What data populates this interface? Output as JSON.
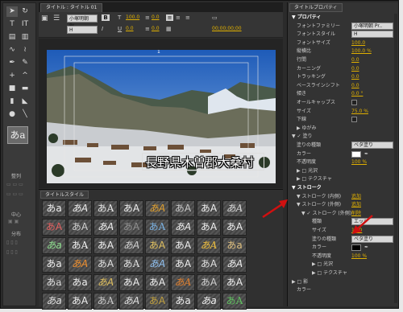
{
  "title_tab": "タイトル : タイトル 01",
  "toolbar": {
    "font_family": "小塚明朝 Pr...",
    "font_style": "H",
    "bold": "B",
    "italic": "I",
    "underline": "U",
    "font_size": "100.0",
    "kerning": "0.0",
    "leading": "0.0",
    "tracking": "0.0",
    "timecode": "00;00;00;00"
  },
  "canvas": {
    "caption": "長野県木曽郡大桑村",
    "marker": "1"
  },
  "tools_panel": {
    "align_label": "整列",
    "center_label": "中心",
    "distribute_label": "分布",
    "style_preview": "あa"
  },
  "styles_panel": {
    "tab": "タイトルスタイル",
    "cells": [
      "あa",
      "あA",
      "あA",
      "あA",
      "あA",
      "あA",
      "あA",
      "あA",
      "あA",
      "あA",
      "あA",
      "あA",
      "あA",
      "あA",
      "あA",
      "あA",
      "あa",
      "あA",
      "あA",
      "あA",
      "あA",
      "あA",
      "あA",
      "あa",
      "あa",
      "あA",
      "あA",
      "あA",
      "あA",
      "あA",
      "あA",
      "あA",
      "あa",
      "あa",
      "あA",
      "あA",
      "あA",
      "あA",
      "あA",
      "あA",
      "あa",
      "あA",
      "あA",
      "あA",
      "あA",
      "あa",
      "あa",
      "あA"
    ],
    "colors": [
      "#f0f0f0",
      "#f0f0f0",
      "#e8e8e8",
      "#f0f0f0",
      "#e0a030",
      "#c8c8c8",
      "#f0f0f0",
      "#d8d8d8",
      "#e06060",
      "#d0d0d0",
      "#f0f0f0",
      "#909090",
      "#7ab0e0",
      "#f0f0f0",
      "#f0f0f0",
      "#f0f0f0",
      "#90e090",
      "#f0f0f0",
      "#f0f0f0",
      "#d0d0d0",
      "#e0c060",
      "#f0f0f0",
      "#f0c040",
      "#e0c080",
      "#f0f0f0",
      "#f09030",
      "#e0e0e0",
      "#e0e0e0",
      "#90c0f0",
      "#f0f0f0",
      "#e0e0e0",
      "#f0f0f0",
      "#e0e0e0",
      "#f0f0f0",
      "#e0c060",
      "#f0f0f0",
      "#f0f0f0",
      "#e08030",
      "#d0d0d0",
      "#f0f0f0",
      "#e0e0e0",
      "#f0f0f0",
      "#c8c8c8",
      "#e0e0e0",
      "#c0a040",
      "#f0f0f0",
      "#f0f0f0",
      "#60c060"
    ]
  },
  "properties": {
    "tab": "タイトルプロパティ",
    "rows": [
      {
        "lbl": "▼ プロパティ",
        "hdr": true,
        "ind": 5
      },
      {
        "lbl": "フォントファミリー",
        "ind": 11,
        "dd": "小塚明朝 Pr.."
      },
      {
        "lbl": "フォントスタイル",
        "ind": 11,
        "dd": "H"
      },
      {
        "lbl": "フォントサイズ",
        "ind": 11,
        "val": "100.0"
      },
      {
        "lbl": "縦横比",
        "ind": 11,
        "val": "100.0 %"
      },
      {
        "lbl": "行間",
        "ind": 11,
        "val": "0.0"
      },
      {
        "lbl": "カーニング",
        "ind": 11,
        "val": "0.0"
      },
      {
        "lbl": "トラッキング",
        "ind": 11,
        "val": "0.0"
      },
      {
        "lbl": "ベースラインシフト",
        "ind": 11,
        "val": "0.0"
      },
      {
        "lbl": "傾き",
        "ind": 11,
        "val": "0.0 °"
      },
      {
        "lbl": "オールキャップス",
        "ind": 11,
        "chk": ""
      },
      {
        "lbl": "サイズ",
        "ind": 11,
        "val": "75.0 %"
      },
      {
        "lbl": "下線",
        "ind": 11,
        "chk": ""
      },
      {
        "lbl": "▶ ゆがみ",
        "ind": 11
      },
      {
        "lbl": "▼ ✓ 塗り",
        "ind": 5
      },
      {
        "lbl": "塗りの種類",
        "ind": 11,
        "dd": "ベタ塗り"
      },
      {
        "lbl": "カラー",
        "ind": 11,
        "swatch": "#ffffff"
      },
      {
        "lbl": "不透明度",
        "ind": 11,
        "val": "100 %"
      },
      {
        "lbl": "▶ □ 光沢",
        "ind": 11
      },
      {
        "lbl": "▶ □ テクスチャ",
        "ind": 11
      },
      {
        "lbl": "▼ ストローク",
        "hdr": true,
        "ind": 5
      },
      {
        "lbl": "▼ ストローク (内側)",
        "ind": 11,
        "val": "追加"
      },
      {
        "lbl": "▼ ストローク (外側)",
        "ind": 11,
        "val": "追加"
      },
      {
        "lbl": "▼ ✓ ストローク (外側)",
        "ind": 17,
        "val": "削除"
      },
      {
        "lbl": "種類",
        "ind": 30,
        "dd": "エッジ"
      },
      {
        "lbl": "サイズ",
        "ind": 30,
        "val": "10.0"
      },
      {
        "lbl": "塗りの種類",
        "ind": 30,
        "dd": "ベタ塗り"
      },
      {
        "lbl": "カラー",
        "ind": 30,
        "swatch": "#000000"
      },
      {
        "lbl": "不透明度",
        "ind": 30,
        "val": "100 %"
      },
      {
        "lbl": "▶ □ 光沢",
        "ind": 30
      },
      {
        "lbl": "▶ □ テクスチャ",
        "ind": 30
      },
      {
        "lbl": "▶ □ 影",
        "ind": 5
      },
      {
        "lbl": "カラー",
        "ind": 11,
        "val": ""
      }
    ]
  },
  "colors": {
    "accent_value": "#e0b000",
    "annotation_arrow": "#d01010"
  }
}
